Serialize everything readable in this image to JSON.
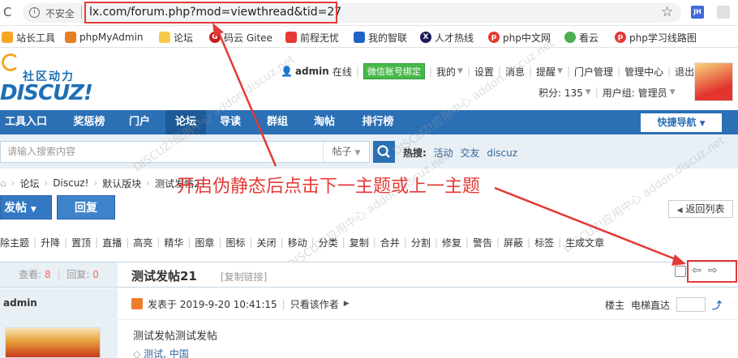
{
  "browser": {
    "back_glyph": "C",
    "insecure_label": "不安全",
    "url": "lx.com/forum.php?mod=viewthread&tid=27",
    "profile_initials": "JH",
    "bookmarks": [
      {
        "label": "站长工具",
        "icon": "chart-icon",
        "color": "#f5a623"
      },
      {
        "label": "phpMyAdmin",
        "icon": "ship-icon",
        "color": "#e67e22"
      },
      {
        "label": "论坛",
        "icon": "folder-icon",
        "color": "#f7c948"
      },
      {
        "label": "码云 Gitee",
        "icon": "gitee-icon",
        "color": "#c71d23"
      },
      {
        "label": "前程无忧",
        "icon": "hand-icon",
        "color": "#e53935"
      },
      {
        "label": "我的智联",
        "icon": "zhilian-icon",
        "color": "#1e64c8"
      },
      {
        "label": "人才热线",
        "icon": "x-circle-icon",
        "color": "#1a1a5e"
      },
      {
        "label": "php中文网",
        "icon": "php-icon",
        "color": "#e53935"
      },
      {
        "label": "看云",
        "icon": "cloud-icon",
        "color": "#4caf50"
      },
      {
        "label": "php学习线路图",
        "icon": "php-icon",
        "color": "#e53935"
      }
    ]
  },
  "header": {
    "logo_cn": "社区动力",
    "logo_en": "DISCUZ!",
    "username": "admin",
    "online": "在线",
    "wechat_bind": "微信账号绑定",
    "links": [
      "我的",
      "设置",
      "消息",
      "提醒",
      "门户管理",
      "管理中心",
      "退出"
    ],
    "points_label": "积分: 135",
    "group_label": "用户组: 管理员"
  },
  "nav": {
    "items": [
      "工具入口",
      "奖惩榜",
      "门户",
      "论坛",
      "导读",
      "群组",
      "淘帖",
      "排行榜"
    ],
    "active": "论坛",
    "quick_nav": "快捷导航"
  },
  "search": {
    "placeholder": "请输入搜索内容",
    "type": "帖子",
    "hot_label": "热搜:",
    "hot_terms": [
      "活动",
      "交友",
      "discuz"
    ]
  },
  "breadcrumb": [
    "论坛",
    "Discuz!",
    "默认版块",
    "测试发帖21"
  ],
  "annotation_text": "开启伪静态后点击下一主题或上一主题",
  "actions": {
    "post": "发帖",
    "reply": "回复",
    "back_to_list": "返回列表"
  },
  "mod_tools": [
    "除主题",
    "升降",
    "置顶",
    "直播",
    "高亮",
    "精华",
    "图章",
    "图标",
    "关闭",
    "移动",
    "分类",
    "复制",
    "合并",
    "分割",
    "修复",
    "警告",
    "屏蔽",
    "标签",
    "生成文章"
  ],
  "thread": {
    "views_label": "查看:",
    "views": "8",
    "replies_label": "回复:",
    "replies": "0",
    "title": "测试发帖21",
    "copy_link": "[复制链接]",
    "author": "admin",
    "posted": "发表于 2019-9-20 10:41:15",
    "only_author": "只看该作者",
    "floor": "楼主",
    "elevator": "电梯直达",
    "body": "测试发帖测试发帖",
    "tags": "测试, 中国"
  },
  "watermark": "DISCUZ!应用中心 addon.discuz.net",
  "colors": {
    "nav_blue": "#2b6fb5",
    "annotation_red": "#e53935",
    "light_blue_bg": "#e8eff5"
  }
}
